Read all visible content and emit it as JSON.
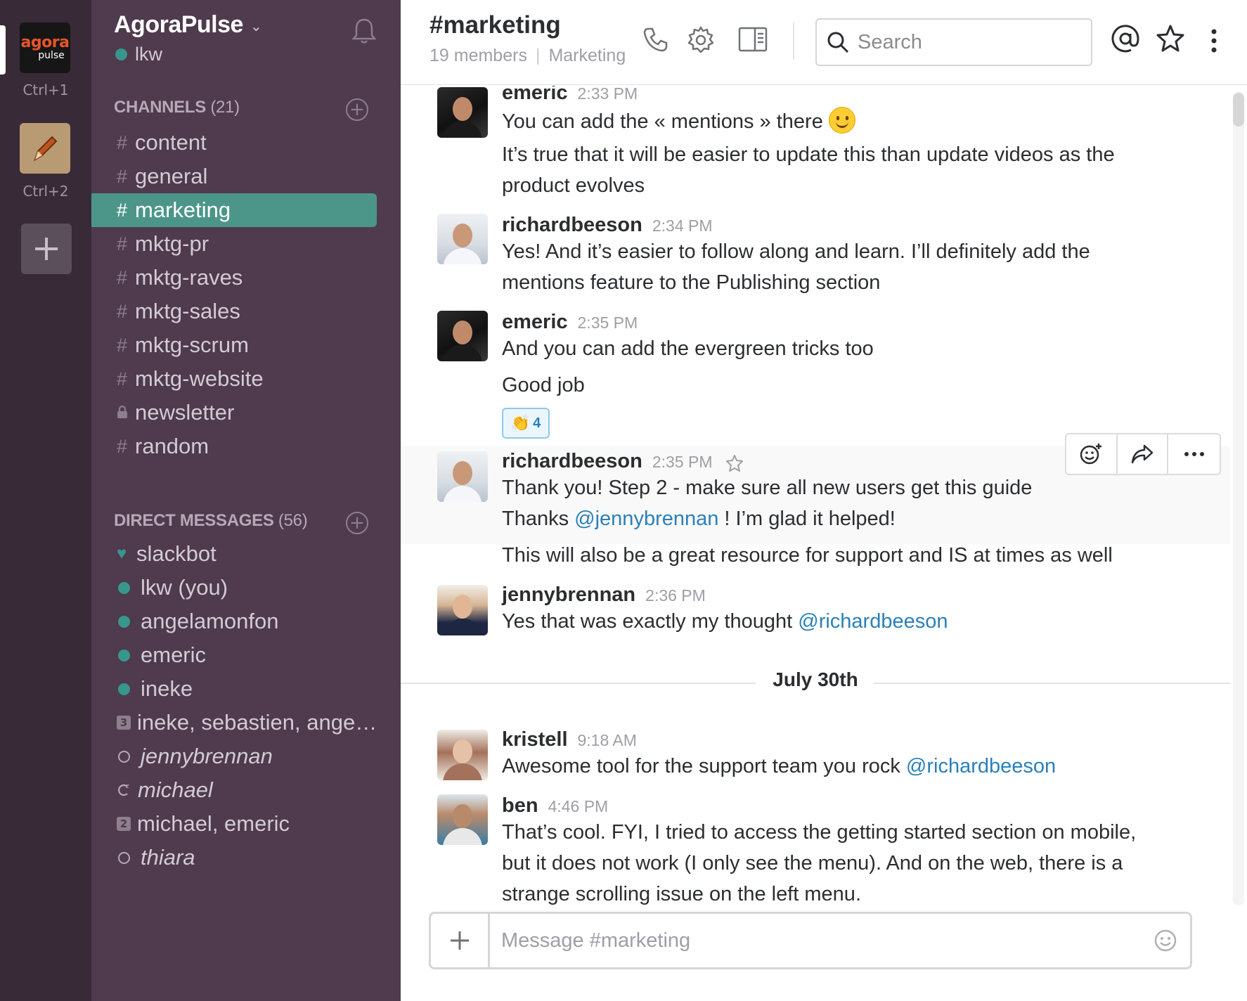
{
  "teams": [
    {
      "logo_top": "agora",
      "logo_bottom": "pulse",
      "shortcut": "Ctrl+1"
    },
    {
      "icon": "pencil-icon",
      "shortcut": "Ctrl+2"
    }
  ],
  "add_team_icon": "plus-icon",
  "sidebar": {
    "team_name": "AgoraPulse",
    "team_chevron": "⌄",
    "user": "lkw",
    "channels_header": "CHANNELS",
    "channels_count": "(21)",
    "channels": [
      {
        "prefix": "#",
        "label": "content"
      },
      {
        "prefix": "#",
        "label": "general"
      },
      {
        "prefix": "#",
        "label": "marketing",
        "active": true
      },
      {
        "prefix": "#",
        "label": "mktg-pr"
      },
      {
        "prefix": "#",
        "label": "mktg-raves"
      },
      {
        "prefix": "#",
        "label": "mktg-sales"
      },
      {
        "prefix": "#",
        "label": "mktg-scrum"
      },
      {
        "prefix": "#",
        "label": "mktg-website"
      },
      {
        "prefix": "lock",
        "label": "newsletter"
      },
      {
        "prefix": "#",
        "label": "random"
      }
    ],
    "dm_header": "DIRECT MESSAGES",
    "dm_count": "(56)",
    "dms": [
      {
        "label": "slackbot"
      },
      {
        "label": "lkw (you)"
      },
      {
        "label": "angelamonfon"
      },
      {
        "label": "emeric"
      },
      {
        "label": "ineke"
      },
      {
        "label": "ineke, sebastien, ange…",
        "badge": "3"
      },
      {
        "label": "jennybrennan"
      },
      {
        "label": "michael"
      },
      {
        "label": "michael, emeric",
        "badge": "2"
      },
      {
        "label": "thiara"
      }
    ]
  },
  "header": {
    "channel": "#marketing",
    "members": "19 members",
    "topic": "Marketing",
    "search_placeholder": "Search"
  },
  "messages": [
    {
      "author": "emeric",
      "time": "2:33 PM",
      "lines": [
        "You can add the « mentions » there",
        "It’s true that it will be easier to update this than update videos as the",
        "product evolves"
      ]
    },
    {
      "author": "richardbeeson",
      "time": "2:34 PM",
      "lines": [
        "Yes!  And it’s easier to follow along and learn. I’ll definitely add the",
        "mentions feature to the Publishing section"
      ]
    },
    {
      "author": "emeric",
      "time": "2:35 PM",
      "lines": [
        "And you can add the evergreen tricks too",
        "Good job"
      ],
      "reaction": {
        "emoji": "👏",
        "count": "4"
      }
    },
    {
      "author": "richardbeeson",
      "time": "2:35 PM",
      "lines": [
        "Thank you! Step 2 - make sure all new users get this guide",
        "Thanks ",
        "@jennybrennan",
        " !  I’m glad it helped!",
        "This will also be a great resource for support and IS at times as well"
      ]
    },
    {
      "author": "jennybrennan",
      "time": "2:36 PM",
      "lines": [
        "Yes that was exactly my thought ",
        "@richardbeeson"
      ]
    },
    {
      "author": "kristell",
      "time": "9:18 AM",
      "lines": [
        "Awesome tool for the support team you rock ",
        "@richardbeeson"
      ]
    },
    {
      "author": "ben",
      "time": "4:46 PM",
      "lines": [
        "That’s cool. FYI, I tried to access the getting started section on mobile,",
        "but it does not work (I only see the menu). And on the web, there is a",
        "strange scrolling issue on the left menu."
      ]
    }
  ],
  "day_divider": "July 30th",
  "composer_placeholder": "Message #marketing"
}
